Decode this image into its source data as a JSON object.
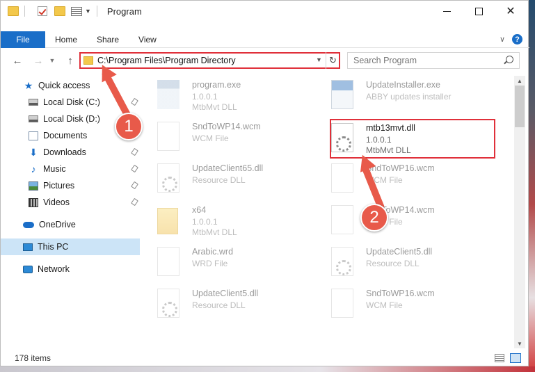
{
  "window": {
    "title": "Program"
  },
  "ribbon": {
    "tabs": [
      "File",
      "Home",
      "Share",
      "View"
    ]
  },
  "address": {
    "path": "C:\\Program Files\\Program Directory"
  },
  "search": {
    "placeholder": "Search Program"
  },
  "sidebar": {
    "items": [
      {
        "label": "Quick access",
        "icon": "star-icon"
      },
      {
        "label": "Local Disk (C:)",
        "icon": "drive-icon"
      },
      {
        "label": "Local Disk (D:)",
        "icon": "drive-icon"
      },
      {
        "label": "Documents",
        "icon": "documents-icon"
      },
      {
        "label": "Downloads",
        "icon": "download-icon"
      },
      {
        "label": "Music",
        "icon": "music-icon"
      },
      {
        "label": "Pictures",
        "icon": "pictures-icon"
      },
      {
        "label": "Videos",
        "icon": "videos-icon"
      },
      {
        "label": "OneDrive",
        "icon": "cloud-icon"
      },
      {
        "label": "This PC",
        "icon": "computer-icon",
        "selected": true
      },
      {
        "label": "Network",
        "icon": "network-icon"
      }
    ]
  },
  "files": [
    {
      "name": "program.exe",
      "line1": "1.0.0.1",
      "line2": "MtbMvt DLL",
      "icon": "exe-icon"
    },
    {
      "name": "UpdateInstaller.exe",
      "line1": "ABBY updates installer",
      "line2": "",
      "icon": "installer-icon"
    },
    {
      "name": "SndToWP14.wcm",
      "line1": "WCM File",
      "line2": "",
      "icon": "file-icon"
    },
    {
      "name": "mtb13mvt.dll",
      "line1": "1.0.0.1",
      "line2": "MtbMvt DLL",
      "icon": "dll-gear-icon"
    },
    {
      "name": "UpdateClient65.dll",
      "line1": "Resource DLL",
      "line2": "",
      "icon": "dll-gear-icon"
    },
    {
      "name": "SndToWP16.wcm",
      "line1": "WCM File",
      "line2": "",
      "icon": "file-icon"
    },
    {
      "name": "x64",
      "line1": "1.0.0.1",
      "line2": "MtbMvt DLL",
      "icon": "folder-icon"
    },
    {
      "name": "SndToWP14.wcm",
      "line1": "WCM File",
      "line2": "",
      "icon": "file-icon"
    },
    {
      "name": "Arabic.wrd",
      "line1": "WRD File",
      "line2": "",
      "icon": "file-icon"
    },
    {
      "name": "UpdateClient5.dll",
      "line1": "Resource DLL",
      "line2": "",
      "icon": "dll-gear-icon"
    },
    {
      "name": "UpdateClient5.dll",
      "line1": "Resource DLL",
      "line2": "",
      "icon": "dll-gear-icon"
    },
    {
      "name": "SndToWP16.wcm",
      "line1": "WCM File",
      "line2": "",
      "icon": "file-icon"
    }
  ],
  "status": {
    "item_count": "178 items"
  },
  "annotations": {
    "step1": "1",
    "step2": "2",
    "color": "#e85a4a"
  }
}
